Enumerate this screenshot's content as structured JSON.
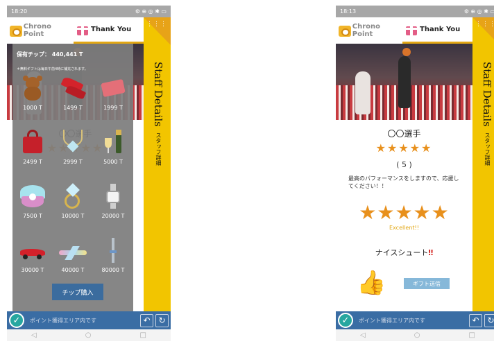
{
  "screens": [
    {
      "status_bar": {
        "time": "18:20",
        "icons": "⚙ ⊕ ◎ ✱ ▭"
      },
      "tabs": [
        {
          "label": "Chrono Point",
          "icon": "gear-icon"
        },
        {
          "label": "Thank You",
          "icon": "gift-icon"
        }
      ],
      "gift_panel": {
        "balance": "保有チップ： 440,441 T",
        "note": "＊無料ギフトは毎日午前4時に補充されます。",
        "gifts": [
          {
            "name": "teddy-bear",
            "price": "1000 T"
          },
          {
            "name": "high-heels",
            "price": "1499 T"
          },
          {
            "name": "wallet",
            "price": "1999 T"
          },
          {
            "name": "handbag",
            "price": "2499 T"
          },
          {
            "name": "necklace",
            "price": "2999 T"
          },
          {
            "name": "champagne",
            "price": "5000 T"
          },
          {
            "name": "pearl-shell",
            "price": "7500 T"
          },
          {
            "name": "diamond-ring",
            "price": "10000 T"
          },
          {
            "name": "watch",
            "price": "20000 T"
          },
          {
            "name": "sports-car",
            "price": "30000 T"
          },
          {
            "name": "airplane",
            "price": "40000 T"
          },
          {
            "name": "tower",
            "price": "80000 T"
          }
        ],
        "buy_label": "チップ購入"
      },
      "side_panel": {
        "title": "Staff Details",
        "subtitle": "スタッフ詳細"
      },
      "bottom_bar": {
        "text": "ポイント獲得エリア内です"
      }
    },
    {
      "status_bar": {
        "time": "18:13",
        "icons": "⚙ ⊕ ◎ ✱ ▭"
      },
      "tabs": [
        {
          "label": "Chrono Point",
          "icon": "gear-icon"
        },
        {
          "label": "Thank You",
          "icon": "gift-icon"
        }
      ],
      "player_name": "〇〇選手",
      "stars": "★★★★★",
      "rating": "( 5 )",
      "message": "最高のパフォーマンスをしますので、応援してください！！",
      "rate_stars": "★★★★★",
      "excellent": "Excellent!!",
      "comment": "ナイスシュート",
      "comment_mark": "‼",
      "send_label": "ギフト送信",
      "side_panel": {
        "title": "Staff Details",
        "subtitle": "スタッフ詳細"
      },
      "bottom_bar": {
        "text": "ポイント獲得エリア内です"
      }
    }
  ],
  "colors": {
    "accent": "#f2c500",
    "bar": "#3a6da4",
    "star": "#e8901c",
    "check": "#27a7a0"
  }
}
